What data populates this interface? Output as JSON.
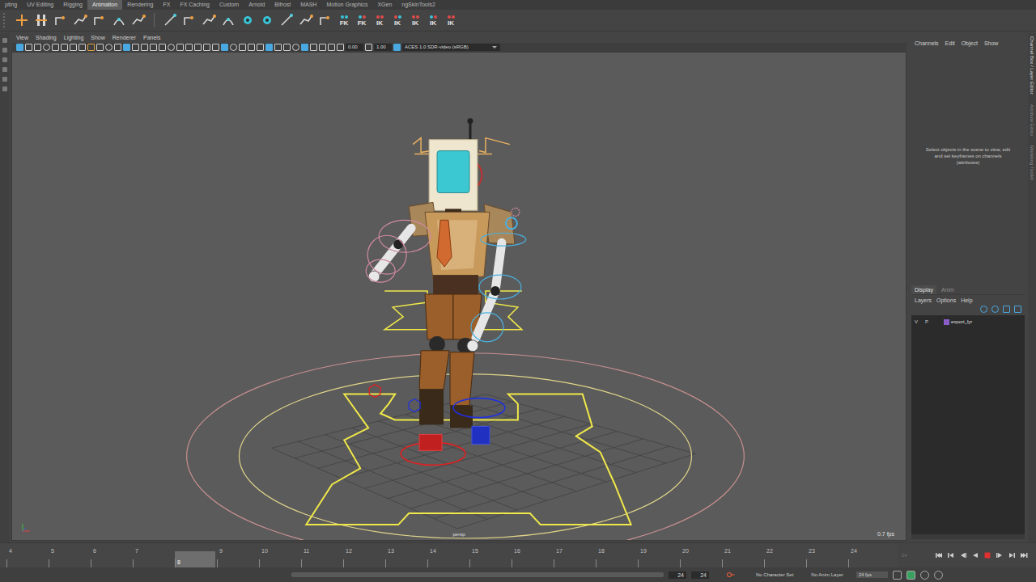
{
  "menu_tabs": [
    {
      "label": "pting",
      "selected": false
    },
    {
      "label": "UV Editing",
      "selected": false
    },
    {
      "label": "Rigging",
      "selected": false
    },
    {
      "label": "Animation",
      "selected": true
    },
    {
      "label": "Rendering",
      "selected": false
    },
    {
      "label": "FX",
      "selected": false
    },
    {
      "label": "FX Caching",
      "selected": false
    },
    {
      "label": "Custom",
      "selected": false
    },
    {
      "label": "Arnold",
      "selected": false
    },
    {
      "label": "Bifrost",
      "selected": false
    },
    {
      "label": "MASH",
      "selected": false
    },
    {
      "label": "Motion Graphics",
      "selected": false
    },
    {
      "label": "XGen",
      "selected": false
    },
    {
      "label": "ngSkinTools2",
      "selected": false
    }
  ],
  "shelf_labels": [
    "FK",
    "FK",
    "IK",
    "IK",
    "IK",
    "IK",
    "IK"
  ],
  "panel_menu": [
    "View",
    "Shading",
    "Lighting",
    "Show",
    "Renderer",
    "Panels"
  ],
  "viewport_toolbar": {
    "exposure": "0.00",
    "gamma": "1.00",
    "color_space": "ACES 1.0 SDR-video (sRGB)"
  },
  "viewport": {
    "camera": "persp",
    "fps": "0.7 fps"
  },
  "channel_box": {
    "menu": [
      "Channels",
      "Edit",
      "Object",
      "Show"
    ],
    "message": "Select objects in the scene to view, edit and set keyframes on channels (attributes)"
  },
  "side_tabs": [
    "Channel Box / Layer Editor",
    "Attribute Editor",
    "Modeling Toolkit"
  ],
  "layer_editor": {
    "tabs": [
      {
        "label": "Display",
        "selected": true
      },
      {
        "label": "Anim",
        "selected": false
      }
    ],
    "menu": [
      "Layers",
      "Options",
      "Help"
    ],
    "layers": [
      {
        "visible": "V",
        "playback": "P",
        "name": "export_lyr",
        "color": "#8a5cc8"
      }
    ]
  },
  "timeline": {
    "frames": [
      {
        "label": "4",
        "selected": false
      },
      {
        "label": "5",
        "selected": false
      },
      {
        "label": "6",
        "selected": false
      },
      {
        "label": "7",
        "selected": false
      },
      {
        "label": "8",
        "selected": true
      },
      {
        "label": "9",
        "selected": false
      },
      {
        "label": "10",
        "selected": false
      },
      {
        "label": "11",
        "selected": false
      },
      {
        "label": "12",
        "selected": false
      },
      {
        "label": "13",
        "selected": false
      },
      {
        "label": "14",
        "selected": false
      },
      {
        "label": "15",
        "selected": false
      },
      {
        "label": "16",
        "selected": false
      },
      {
        "label": "17",
        "selected": false
      },
      {
        "label": "18",
        "selected": false
      },
      {
        "label": "19",
        "selected": false
      },
      {
        "label": "20",
        "selected": false
      },
      {
        "label": "21",
        "selected": false
      },
      {
        "label": "22",
        "selected": false
      },
      {
        "label": "23",
        "selected": false
      },
      {
        "label": "24",
        "selected": false
      }
    ],
    "end": "24"
  },
  "range": {
    "start": "24",
    "end": "24",
    "character_set": "No Character Set",
    "anim_layer": "No Anim Layer",
    "fps": "24 fps"
  },
  "auto_key": true
}
